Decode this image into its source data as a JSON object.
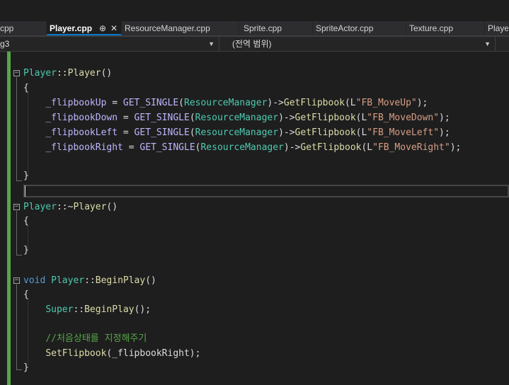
{
  "tabs": [
    {
      "label": "cpp",
      "active": false
    },
    {
      "label": "Player.cpp",
      "active": true,
      "pin": "⊕",
      "close": "✕"
    },
    {
      "label": "ResourceManager.cpp",
      "active": false
    },
    {
      "label": "Sprite.cpp",
      "active": false
    },
    {
      "label": "SpriteActor.cpp",
      "active": false
    },
    {
      "label": "Texture.cpp",
      "active": false
    },
    {
      "label": "Player",
      "active": false
    }
  ],
  "navbar": {
    "project_dropdown": "g3",
    "scope_dropdown": "(전역 범위)",
    "member_dropdown": ""
  },
  "code": {
    "l1": {
      "class": "Player",
      "sep": "::",
      "fn": "Player",
      "rest": "()"
    },
    "l2": "{",
    "l3": {
      "indent": "    ",
      "var": "_flipbookUp",
      "eq": " = ",
      "macro": "GET_SINGLE",
      "p1": "(",
      "type": "ResourceManager",
      "p2": ")->",
      "fn": "GetFlipbook",
      "p3": "(L",
      "str": "\"FB_MoveUp\"",
      "end": ");"
    },
    "l4": {
      "indent": "    ",
      "var": "_flipbookDown",
      "eq": " = ",
      "macro": "GET_SINGLE",
      "p1": "(",
      "type": "ResourceManager",
      "p2": ")->",
      "fn": "GetFlipbook",
      "p3": "(L",
      "str": "\"FB_MoveDown\"",
      "end": ");"
    },
    "l5": {
      "indent": "    ",
      "var": "_flipbookLeft",
      "eq": " = ",
      "macro": "GET_SINGLE",
      "p1": "(",
      "type": "ResourceManager",
      "p2": ")->",
      "fn": "GetFlipbook",
      "p3": "(L",
      "str": "\"FB_MoveLeft\"",
      "end": ");"
    },
    "l6": {
      "indent": "    ",
      "var": "_flipbookRight",
      "eq": " = ",
      "macro": "GET_SINGLE",
      "p1": "(",
      "type": "ResourceManager",
      "p2": ")->",
      "fn": "GetFlipbook",
      "p3": "(L",
      "str": "\"FB_MoveRight\"",
      "end": ");"
    },
    "l7": "}",
    "l8": {
      "class": "Player",
      "sep": "::",
      "tilde": "~",
      "fn": "Player",
      "rest": "()"
    },
    "l9": "{",
    "l10": "}",
    "l11": {
      "kw": "void",
      "sp": " ",
      "class": "Player",
      "sep": "::",
      "fn": "BeginPlay",
      "rest": "()"
    },
    "l12": "{",
    "l13": {
      "indent": "    ",
      "cls": "Super",
      "sep": "::",
      "fn": "BeginPlay",
      "rest": "();"
    },
    "l14": {
      "indent": "    ",
      "comment": "//처음상태를 지정해주기"
    },
    "l15": {
      "indent": "    ",
      "fn": "SetFlipbook",
      "rest": "(_flipbookRight);"
    },
    "l16": "}"
  },
  "colors": {
    "type": "#4ec9b0",
    "keyword": "#569cd6",
    "function": "#dcdcaa",
    "string": "#d69d85",
    "comment": "#57a64a",
    "macro": "#beb7ff",
    "active_tab_underline": "#007acc"
  }
}
